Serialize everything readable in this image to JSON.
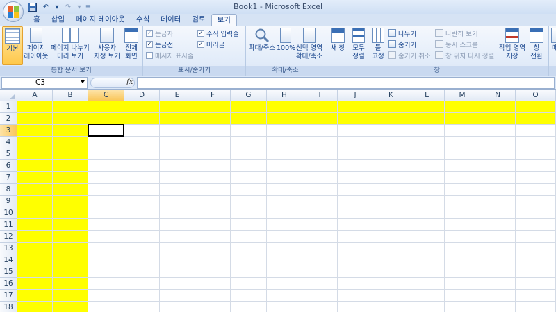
{
  "window": {
    "title": "Book1 - Microsoft Excel"
  },
  "qat": {
    "save_icon": "save-icon",
    "undo_icon": "undo-icon",
    "redo_icon": "redo-icon",
    "customize_icon": "chevron-down-icon"
  },
  "tabs": [
    {
      "label": "홈",
      "active": false
    },
    {
      "label": "삽입",
      "active": false
    },
    {
      "label": "페이지 레이아웃",
      "active": false
    },
    {
      "label": "수식",
      "active": false
    },
    {
      "label": "데이터",
      "active": false
    },
    {
      "label": "검토",
      "active": false
    },
    {
      "label": "보기",
      "active": true
    }
  ],
  "ribbon": {
    "workbook_views": {
      "label": "통합 문서 보기",
      "normal": "기본",
      "page_layout_1": "페이지",
      "page_layout_2": "레이아웃",
      "page_break_1": "페이지 나누기",
      "page_break_2": "미리 보기",
      "custom_1": "사용자",
      "custom_2": "지정 보기",
      "full_1": "전체",
      "full_2": "화면"
    },
    "show_hide": {
      "label": "표시/숨기기",
      "ruler": "눈금자",
      "formula_bar": "수식 입력줄",
      "gridlines": "눈금선",
      "headings": "머리글",
      "message_bar": "메시지 표시줄"
    },
    "zoom": {
      "label": "확대/축소",
      "zoom": "확대/축소",
      "hundred": "100%",
      "selection_1": "선택 영역",
      "selection_2": "확대/축소"
    },
    "window": {
      "label": "창",
      "new_window": "새 창",
      "arrange_1": "모두",
      "arrange_2": "정렬",
      "freeze_1": "틀",
      "freeze_2": "고정",
      "split": "나누기",
      "hide": "숨기기",
      "unhide": "숨기기 취소",
      "side_by_side": "나란히 보기",
      "sync_scroll": "동시 스크롤",
      "reset_pos": "창 위치 다시 정렬",
      "save_ws_1": "작업 영역",
      "save_ws_2": "저장",
      "switch_1": "창",
      "switch_2": "전환"
    },
    "macros": {
      "label_1": "매"
    }
  },
  "formula_bar": {
    "name_box": "C3",
    "fx": "fx",
    "value": ""
  },
  "grid": {
    "columns": [
      "A",
      "B",
      "C",
      "D",
      "E",
      "F",
      "G",
      "H",
      "I",
      "J",
      "K",
      "L",
      "M",
      "N",
      "O"
    ],
    "rows": [
      "1",
      "2",
      "3",
      "4",
      "5",
      "6",
      "7",
      "8",
      "9",
      "10",
      "11",
      "12",
      "13",
      "14",
      "15",
      "16",
      "17",
      "18"
    ],
    "active_cell": "C3",
    "highlight_color": "#FFFF00"
  }
}
